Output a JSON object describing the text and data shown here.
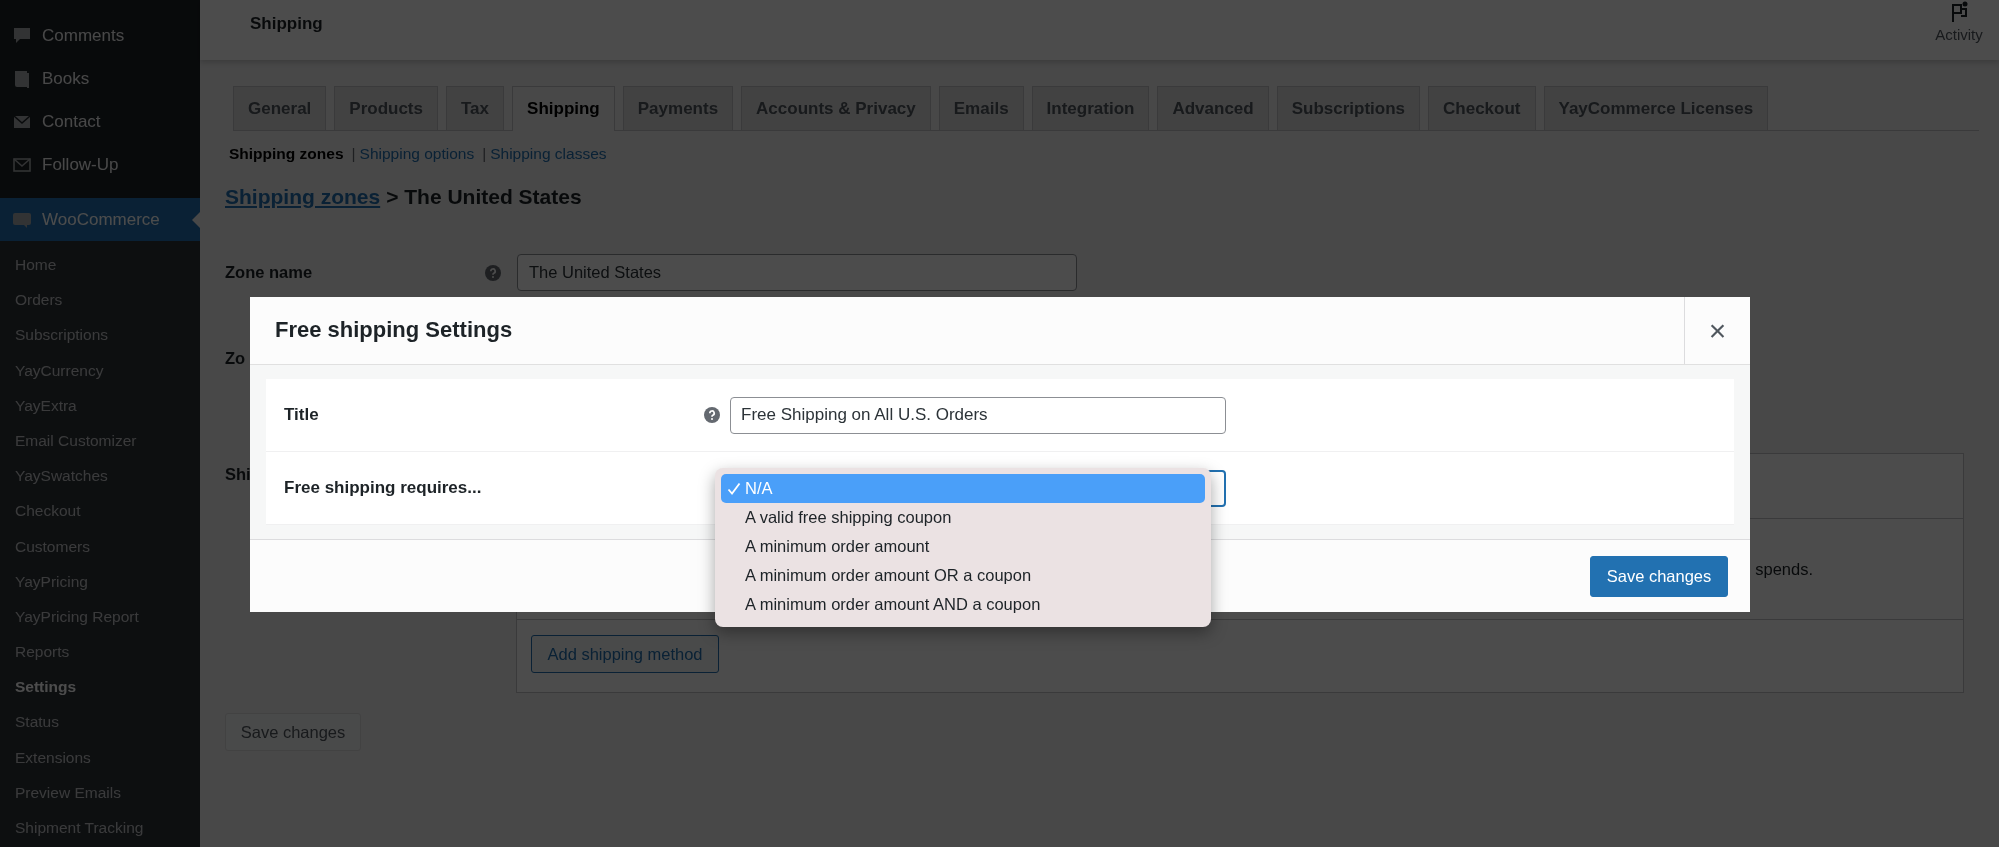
{
  "sidebar": {
    "menu": [
      {
        "label": "Comments",
        "selected": false
      },
      {
        "label": "Books",
        "selected": false
      },
      {
        "label": "Contact",
        "selected": false
      },
      {
        "label": "Follow-Up",
        "selected": false
      },
      {
        "label": "WooCommerce",
        "selected": true
      }
    ],
    "submenu": [
      {
        "label": "Home",
        "selected": false
      },
      {
        "label": "Orders",
        "selected": false
      },
      {
        "label": "Subscriptions",
        "selected": false
      },
      {
        "label": "YayCurrency",
        "selected": false
      },
      {
        "label": "YayExtra",
        "selected": false
      },
      {
        "label": "Email Customizer",
        "selected": false
      },
      {
        "label": "YaySwatches",
        "selected": false
      },
      {
        "label": "Checkout",
        "selected": false
      },
      {
        "label": "Customers",
        "selected": false
      },
      {
        "label": "YayPricing",
        "selected": false
      },
      {
        "label": "YayPricing Report",
        "selected": false
      },
      {
        "label": "Reports",
        "selected": false
      },
      {
        "label": "Settings",
        "selected": true
      },
      {
        "label": "Status",
        "selected": false
      },
      {
        "label": "Extensions",
        "selected": false
      },
      {
        "label": "Preview Emails",
        "selected": false
      },
      {
        "label": "Shipment Tracking",
        "selected": false
      }
    ]
  },
  "header": {
    "title": "Shipping",
    "activity": "Activity"
  },
  "tabs": [
    {
      "label": "General",
      "selected": false
    },
    {
      "label": "Products",
      "selected": false
    },
    {
      "label": "Tax",
      "selected": false
    },
    {
      "label": "Shipping",
      "selected": true
    },
    {
      "label": "Payments",
      "selected": false
    },
    {
      "label": "Accounts & Privacy",
      "selected": false
    },
    {
      "label": "Emails",
      "selected": false
    },
    {
      "label": "Integration",
      "selected": false
    },
    {
      "label": "Advanced",
      "selected": false
    },
    {
      "label": "Subscriptions",
      "selected": false
    },
    {
      "label": "Checkout",
      "selected": false
    },
    {
      "label": "YayCommerce Licenses",
      "selected": false
    }
  ],
  "subnav": [
    {
      "label": "Shipping zones",
      "selected": true
    },
    {
      "label": "Shipping options",
      "separator": "|",
      "selected": false
    },
    {
      "label": "Shipping classes",
      "separator": "|",
      "selected": false
    }
  ],
  "breadcrumb": {
    "link": "Shipping zones",
    "current": "> The United States"
  },
  "form": {
    "zone_name_label": "Zone name",
    "zone_name_value": "The United States",
    "row_2_label": "Zo",
    "row_3_label": "Shi"
  },
  "methods_table": {
    "partial_text": "spends.",
    "add_button": "Add shipping method"
  },
  "save_button": {
    "label": "Save changes",
    "disabled": true
  },
  "modal": {
    "title": "Free shipping Settings",
    "close": "×",
    "title_label": "Title",
    "title_value": "Free Shipping on All U.S. Orders",
    "requires_label": "Free shipping requires...",
    "options": [
      {
        "label": "N/A",
        "selected": true
      },
      {
        "label": "A valid free shipping coupon",
        "selected": false
      },
      {
        "label": "A minimum order amount",
        "selected": false
      },
      {
        "label": "A minimum order amount OR a coupon",
        "selected": false
      },
      {
        "label": "A minimum order amount AND a coupon",
        "selected": false
      }
    ],
    "save_button": "Save changes"
  }
}
